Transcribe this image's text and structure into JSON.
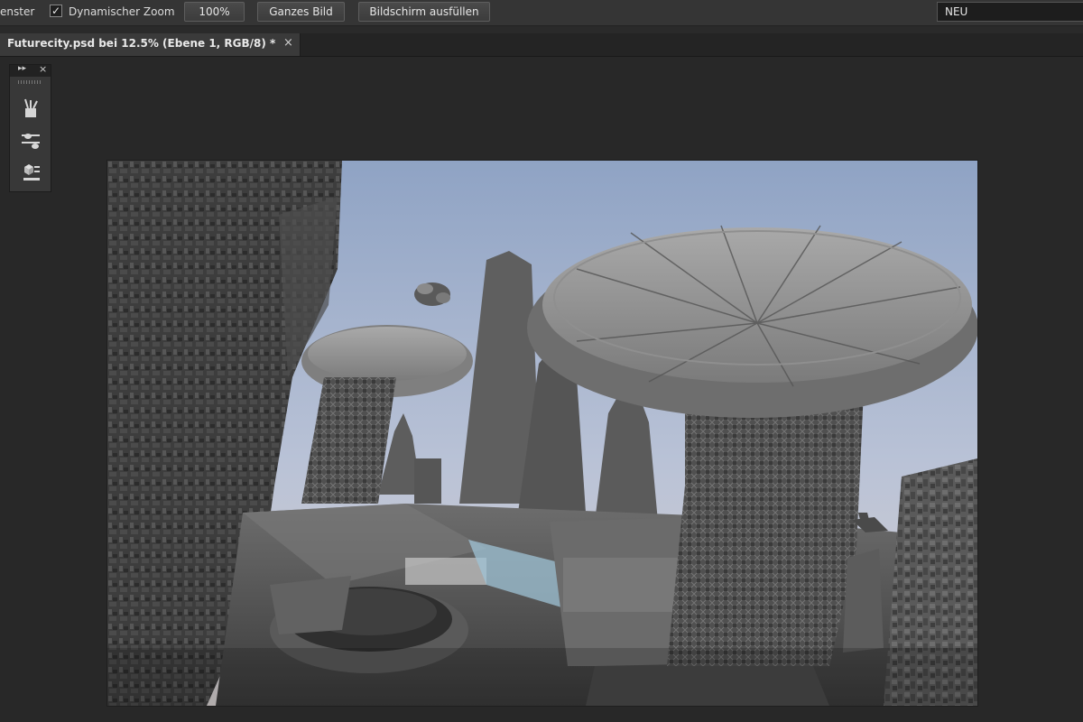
{
  "options_bar": {
    "window_text": "enster",
    "dynamic_zoom_label": "Dynamischer Zoom",
    "dynamic_zoom_checked": "✓",
    "zoom_100_label": "100%",
    "fit_screen_label": "Ganzes Bild",
    "fill_screen_label": "Bildschirm ausfüllen",
    "workspace_value": "NEU"
  },
  "document_tab": {
    "title": "Futurecity.psd bei 12.5% (Ebene 1, RGB/8) *",
    "close_glyph": "×"
  },
  "panel": {
    "expand_glyph": "▸▸",
    "close_glyph": "×",
    "icons": [
      "brushes-icon",
      "brush-presets-icon",
      "clone-source-icon"
    ]
  },
  "colors": {
    "app_background": "#282828",
    "options_bar": "#353535",
    "sky_top": "#8fa3c4",
    "sky_bottom": "#d8d2d2"
  },
  "document_image": {
    "description_icon": "futurecity-render-image"
  }
}
